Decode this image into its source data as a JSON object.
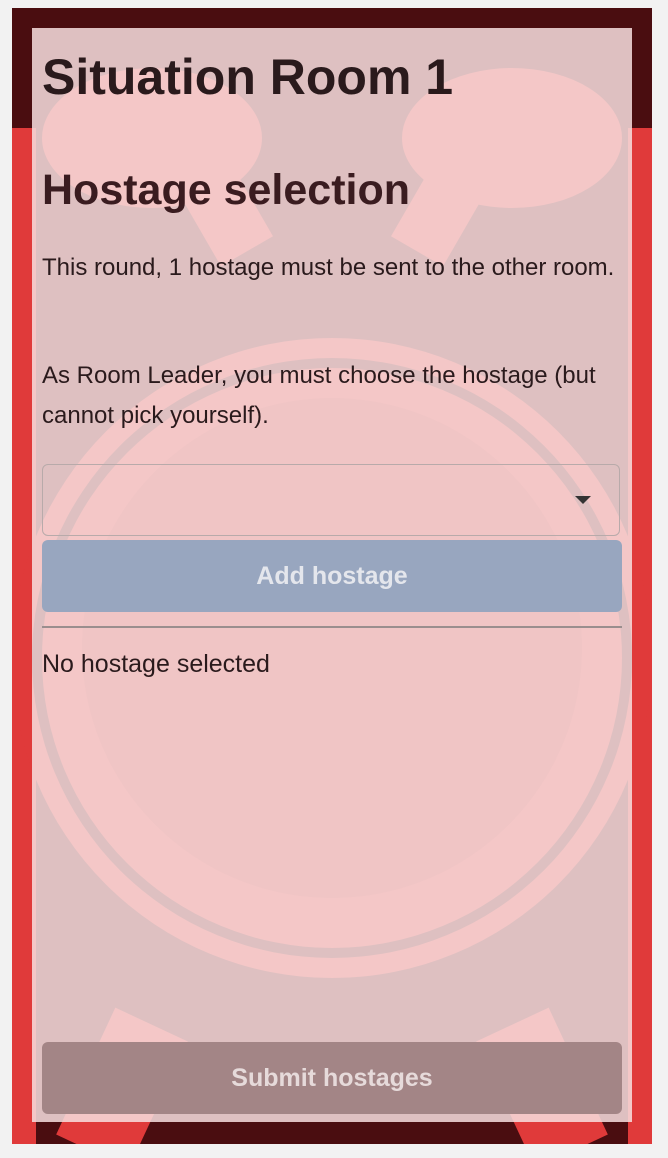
{
  "page": {
    "title": "Situation Room 1",
    "section_heading": "Hostage selection",
    "instruction_1": "This round, 1 hostage must be sent to the other room.",
    "instruction_2": "As Room Leader, you must choose the hostage (but cannot pick yourself)."
  },
  "hostage_select": {
    "value": "",
    "icon": "chevron-down-icon"
  },
  "buttons": {
    "add_label": "Add hostage",
    "submit_label": "Submit hostages"
  },
  "selection": {
    "status_text": "No hostage selected"
  },
  "colors": {
    "background_dark": "#4a0d10",
    "background_red": "#e03a3a",
    "panel": "#f7dede",
    "add_button": "#98a6bf",
    "submit_button": "#a38586"
  }
}
